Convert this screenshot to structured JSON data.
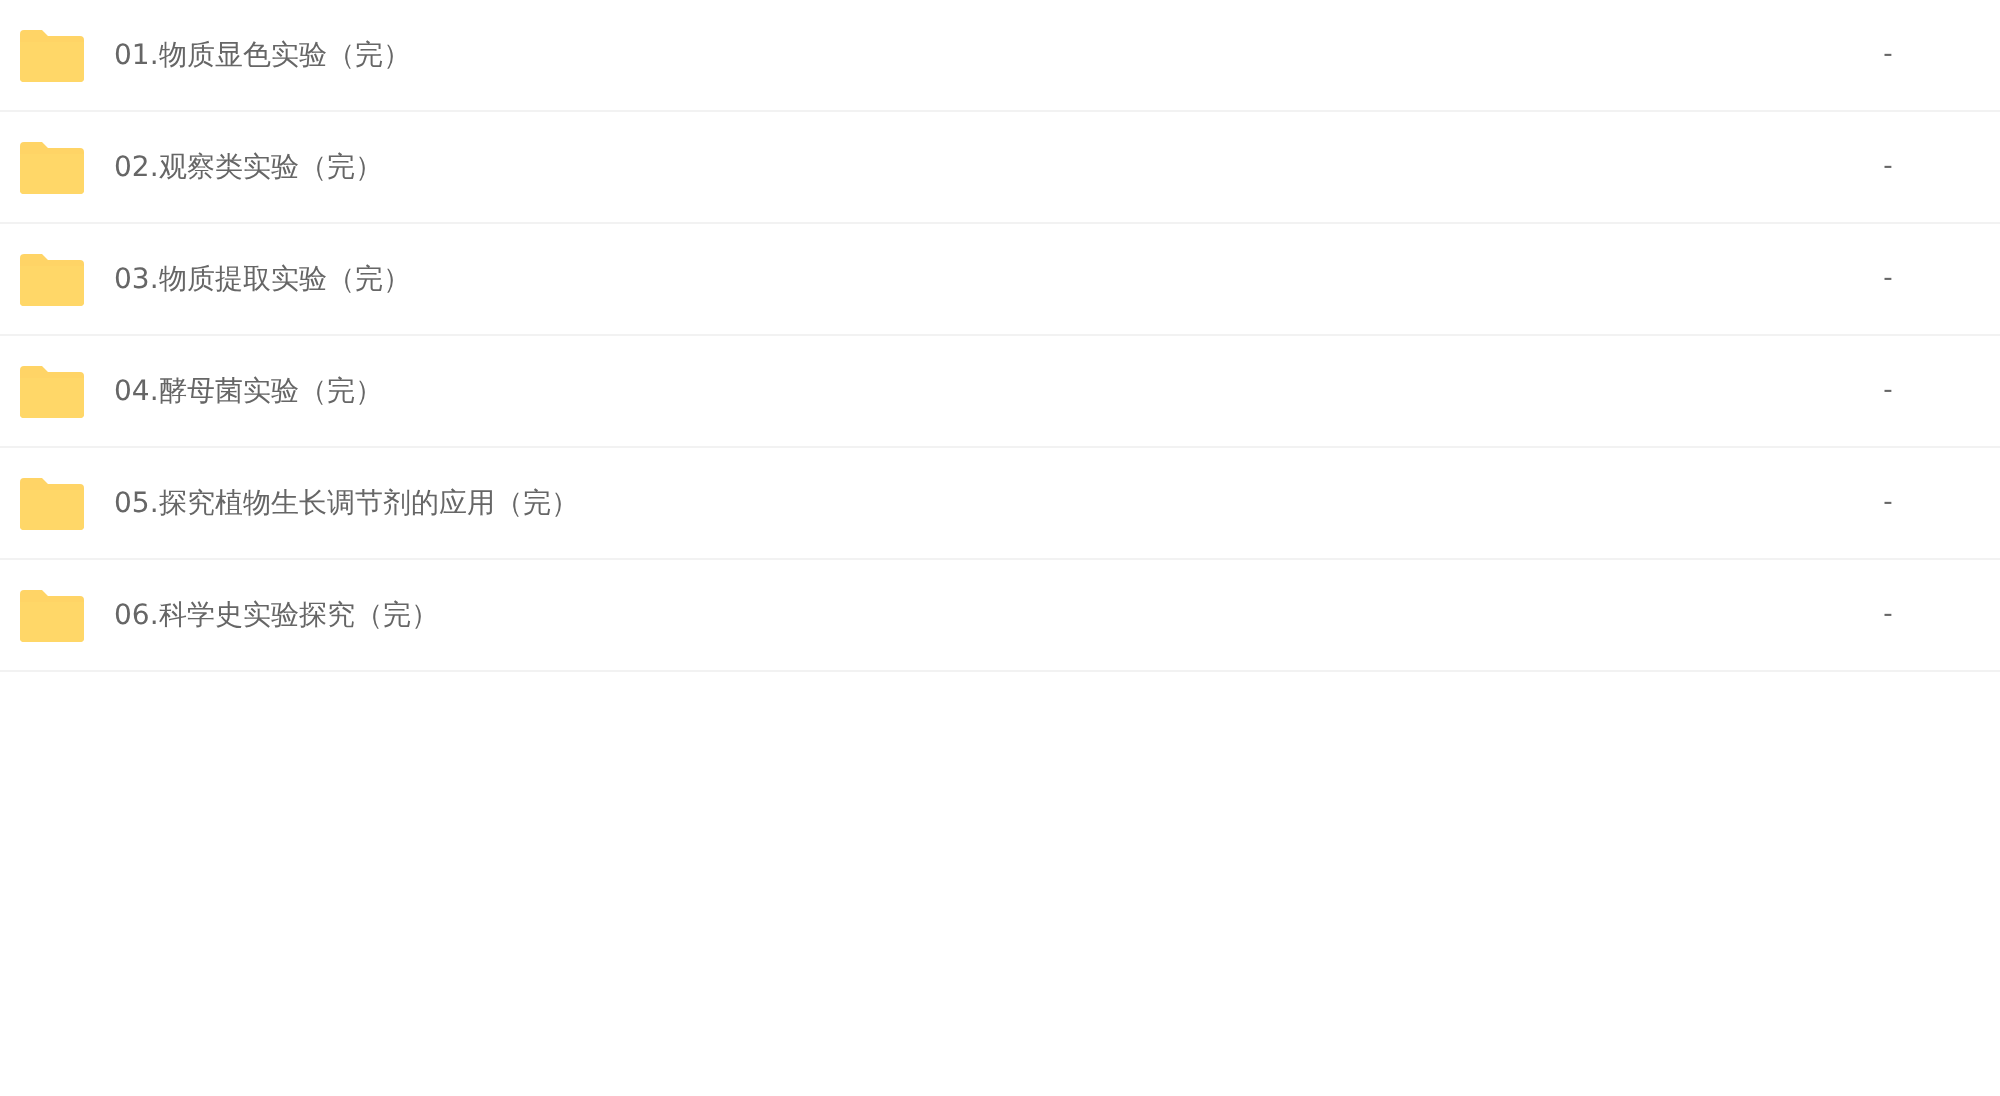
{
  "files": [
    {
      "name": "01.物质显色实验（完）",
      "size": "-"
    },
    {
      "name": "02.观察类实验（完）",
      "size": "-"
    },
    {
      "name": "03.物质提取实验（完）",
      "size": "-"
    },
    {
      "name": "04.酵母菌实验（完）",
      "size": "-"
    },
    {
      "name": "05.探究植物生长调节剂的应用（完）",
      "size": "-"
    },
    {
      "name": "06.科学史实验探究（完）",
      "size": "-"
    }
  ]
}
